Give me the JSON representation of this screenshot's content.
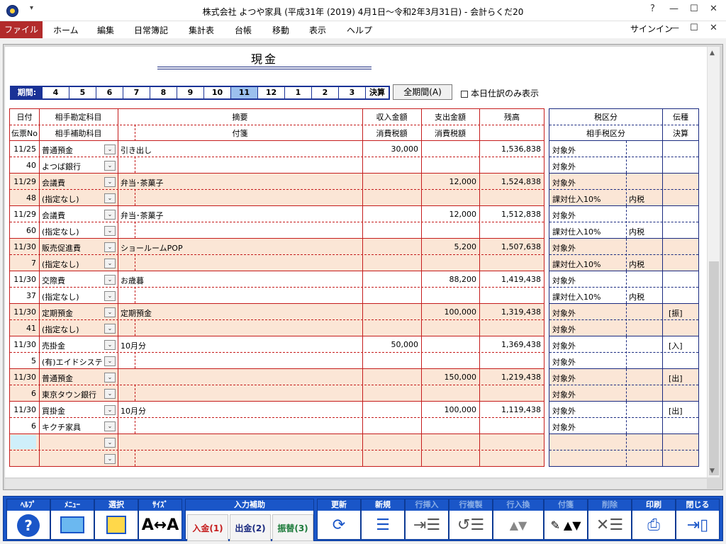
{
  "window": {
    "title": "株式会社 よつや家具 (平成31年 (2019) 4月1日～令和2年3月31日) - 会計らくだ20",
    "help": "?",
    "minimize": "—",
    "maximize": "☐",
    "close": "✕",
    "qat": "▾"
  },
  "menu": {
    "items": [
      "ファイル",
      "ホーム",
      "編集",
      "日常簿記",
      "集計表",
      "台帳",
      "移動",
      "表示",
      "ヘルプ"
    ],
    "signin": "サインイン"
  },
  "page_title": "現金",
  "period": {
    "label": "期間:",
    "months": [
      "4",
      "5",
      "6",
      "7",
      "8",
      "9",
      "10",
      "11",
      "12",
      "1",
      "2",
      "3"
    ],
    "active": "11",
    "closing": "決算"
  },
  "all_period_button": "全期間(A)",
  "today_only_label": "本日仕訳のみ表示",
  "headers": {
    "date": "日付",
    "slip": "伝票No",
    "account": "相手勘定科目",
    "subaccount": "相手補助科目",
    "summary": "摘要",
    "note": "付箋",
    "income": "収入金額",
    "income_tax": "消費税額",
    "expense": "支出金額",
    "expense_tax": "消費税額",
    "balance": "残高",
    "tax_class": "税区分",
    "opp_tax_class": "相手税区分",
    "slip_type": "伝種",
    "settle": "決算"
  },
  "rows": [
    {
      "date": "11/25",
      "no": "40",
      "account": "普通預金",
      "sub": "よつば銀行",
      "summary": "引き出し",
      "income": "30,000",
      "expense": "",
      "balance": "1,536,838",
      "tax": "対象外",
      "tax2": "対象外",
      "taxin": "",
      "type": ""
    },
    {
      "date": "11/29",
      "no": "48",
      "account": "会議費",
      "sub": "(指定なし)",
      "summary": "弁当･茶菓子",
      "income": "",
      "expense": "12,000",
      "balance": "1,524,838",
      "tax": "対象外",
      "tax2": "課対仕入10%",
      "taxin": "内税",
      "type": ""
    },
    {
      "date": "11/29",
      "no": "60",
      "account": "会議費",
      "sub": "(指定なし)",
      "summary": "弁当･茶菓子",
      "income": "",
      "expense": "12,000",
      "balance": "1,512,838",
      "tax": "対象外",
      "tax2": "課対仕入10%",
      "taxin": "内税",
      "type": ""
    },
    {
      "date": "11/30",
      "no": "7",
      "account": "販売促進費",
      "sub": "(指定なし)",
      "summary": "ショールームPOP",
      "income": "",
      "expense": "5,200",
      "balance": "1,507,638",
      "tax": "対象外",
      "tax2": "課対仕入10%",
      "taxin": "内税",
      "type": ""
    },
    {
      "date": "11/30",
      "no": "37",
      "account": "交際費",
      "sub": "(指定なし)",
      "summary": "お歳暮",
      "income": "",
      "expense": "88,200",
      "balance": "1,419,438",
      "tax": "対象外",
      "tax2": "課対仕入10%",
      "taxin": "内税",
      "type": ""
    },
    {
      "date": "11/30",
      "no": "41",
      "account": "定期預金",
      "sub": "(指定なし)",
      "summary": "定期預金",
      "income": "",
      "expense": "100,000",
      "balance": "1,319,438",
      "tax": "対象外",
      "tax2": "対象外",
      "taxin": "",
      "type": "[振]"
    },
    {
      "date": "11/30",
      "no": "5",
      "account": "売掛金",
      "sub": "(有)エイドシステム",
      "summary": "10月分",
      "income": "50,000",
      "expense": "",
      "balance": "1,369,438",
      "tax": "対象外",
      "tax2": "対象外",
      "taxin": "",
      "type": "[入]"
    },
    {
      "date": "11/30",
      "no": "6",
      "account": "普通預金",
      "sub": "東京タウン銀行",
      "summary": "",
      "income": "",
      "expense": "150,000",
      "balance": "1,219,438",
      "tax": "対象外",
      "tax2": "対象外",
      "taxin": "",
      "type": "[出]"
    },
    {
      "date": "11/30",
      "no": "6",
      "account": "買掛金",
      "sub": "キクチ家具",
      "summary": "10月分",
      "income": "",
      "expense": "100,000",
      "balance": "1,119,438",
      "tax": "対象外",
      "tax2": "対象外",
      "taxin": "",
      "type": "[出]"
    }
  ],
  "toolbar": {
    "help": "ﾍﾙﾌﾟ",
    "menu": "ﾒﾆｭｰ",
    "select": "選択",
    "size": "ｻｲｽﾞ",
    "input_assist": "入力補助",
    "deposit": "入金(1)",
    "withdraw": "出金(2)",
    "transfer": "振替(3)",
    "refresh": "更新",
    "new": "新規",
    "row_insert": "行挿入",
    "row_copy": "行複製",
    "row_swap": "行入換",
    "sticky": "付箋",
    "delete": "削除",
    "print": "印刷",
    "close": "閉じる"
  },
  "colors": {
    "accent_red": "#c51c1c",
    "toolbar_blue": "#1a56c8",
    "row_alt": "#fbe6d6"
  }
}
